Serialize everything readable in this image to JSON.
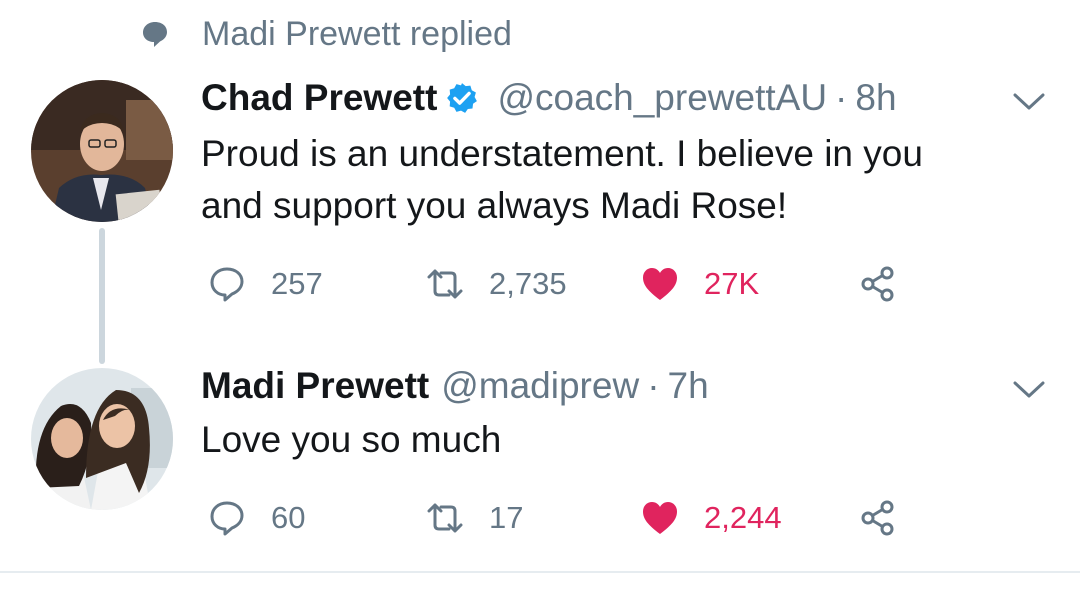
{
  "context": {
    "text": "Madi Prewett replied",
    "icon": "reply-bubble-icon"
  },
  "tweets": [
    {
      "name": "Chad Prewett",
      "verified": true,
      "handle": "@coach_prewettAU",
      "separator": "·",
      "time": "8h",
      "lines": [
        "Proud is an understatement. I believe in you",
        "and support you always Madi Rose!"
      ],
      "replies": "257",
      "retweets": "2,735",
      "likes": "27K",
      "liked": true
    },
    {
      "name": "Madi Prewett",
      "verified": false,
      "handle": "@madiprew",
      "separator": "·",
      "time": "7h",
      "lines": [
        "Love you so much"
      ],
      "replies": "60",
      "retweets": "17",
      "likes": "2,244",
      "liked": true
    }
  ],
  "colors": {
    "like": "#e0245e",
    "verified": "#1da1f2",
    "muted": "#657786",
    "thread_line": "#ccd6dd"
  }
}
